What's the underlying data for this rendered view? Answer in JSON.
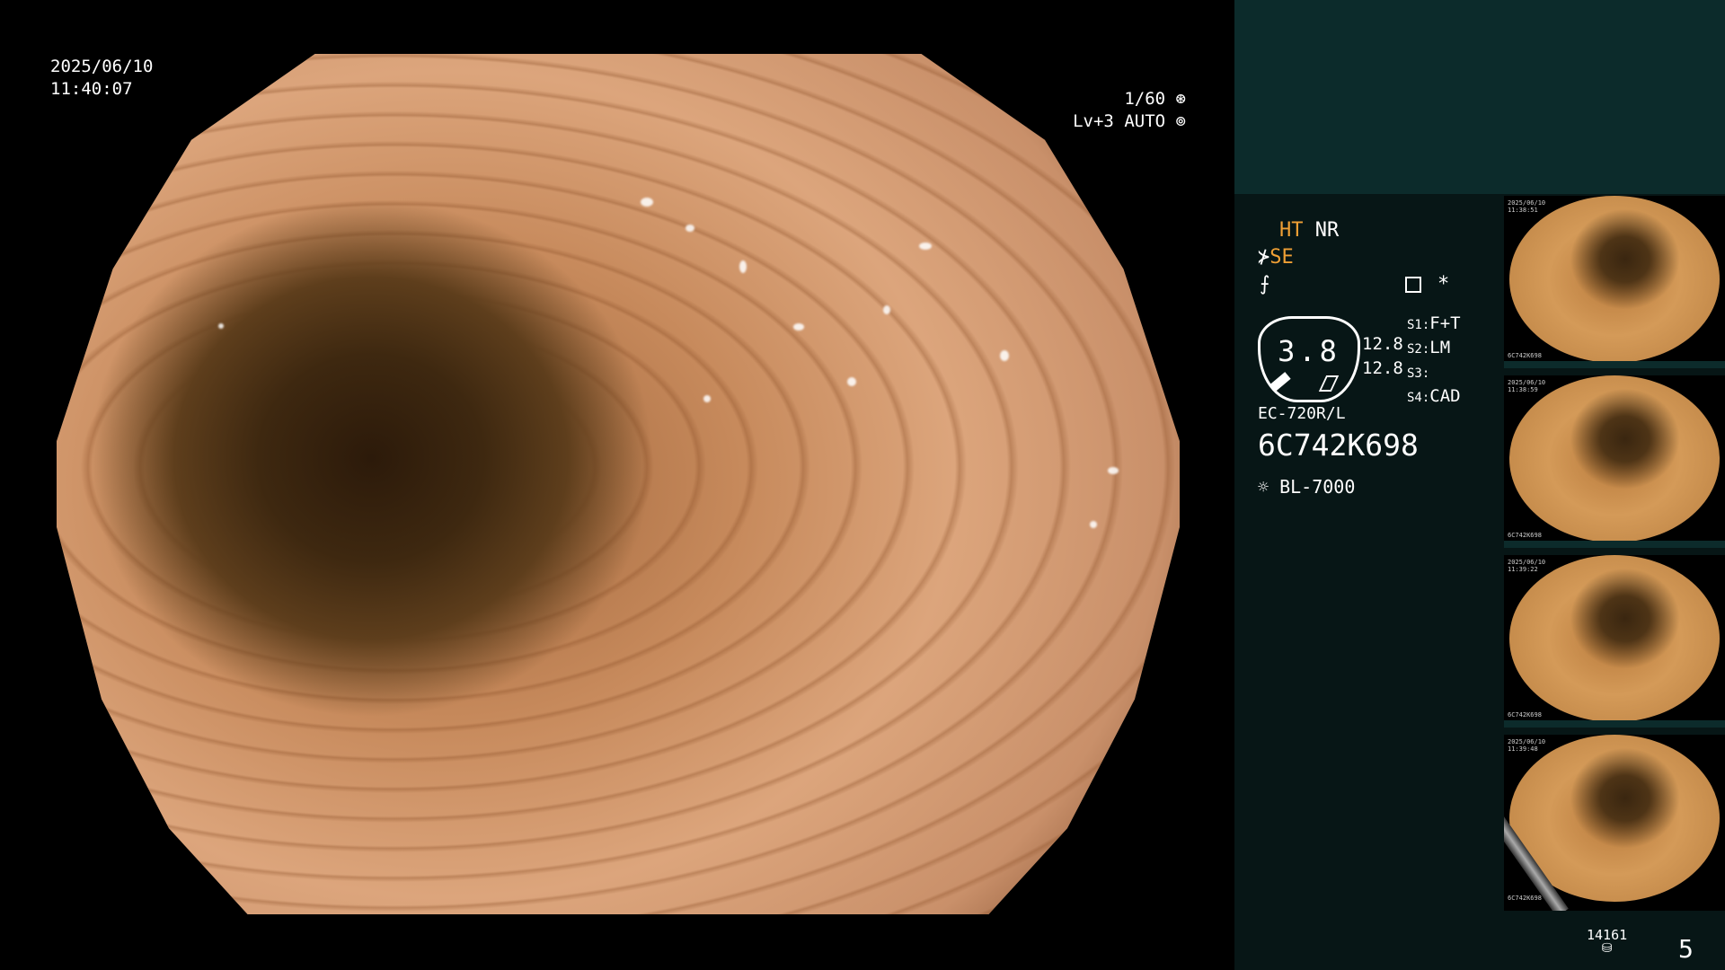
{
  "scope": {
    "date": "2025/06/10",
    "time": "11:40:07",
    "shutter": "1/60",
    "shutter_icon": "aperture-icon",
    "exposure_level": "Lv+3",
    "exposure_mode": "AUTO",
    "exposure_icon": "iris-icon"
  },
  "panel": {
    "mode_ht": "HT",
    "mode_nr": "NR",
    "mode_se": "SE",
    "brightness_value": "3.8",
    "gain_top": "12.8",
    "gain_bottom": "12.8",
    "s1_label": "S1:",
    "s1_value": "F+T",
    "s2_label": "S2:",
    "s2_value": "LM",
    "s3_label": "S3:",
    "s3_value": "",
    "s4_label": "S4:",
    "s4_value": "CAD",
    "asterisk": "*",
    "scope_model": "EC-720R/L",
    "scope_serial": "6C742K698",
    "light_source": "BL-7000",
    "storage_count": "14161",
    "captured_count": "5"
  },
  "thumbnails": [
    {
      "caption_date": "2025/06/10",
      "caption_time": "11:38:51",
      "caption_serial": "6C742K698"
    },
    {
      "caption_date": "2025/06/10",
      "caption_time": "11:38:59",
      "caption_serial": "6C742K698"
    },
    {
      "caption_date": "2025/06/10",
      "caption_time": "11:39:22",
      "caption_serial": "6C742K698"
    },
    {
      "caption_date": "2025/06/10",
      "caption_time": "11:39:48",
      "caption_serial": "6C742K698"
    }
  ],
  "colors": {
    "panel_header": "#0c2b2b",
    "panel_body": "#071616",
    "accent_orange": "#f0a035"
  }
}
